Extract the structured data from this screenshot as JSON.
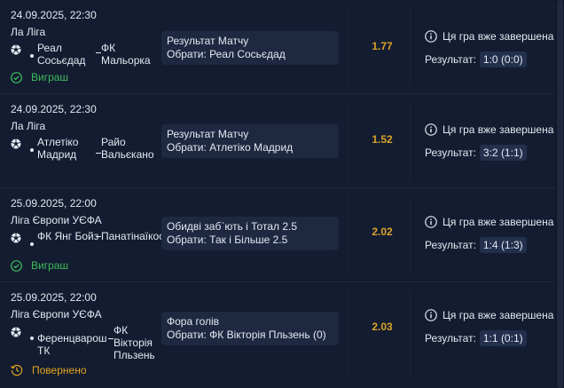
{
  "bets": [
    {
      "date": "24.09.2025, 22:30",
      "league": "Ла Ліга",
      "home": "Реал Сосьєдад",
      "away": "ФК Мальорка",
      "market": "Результат Матчу",
      "pick": "Обрати: Реал Сосьєдад",
      "odds": "1.77",
      "finished": "Ця гра вже завершена",
      "result_label": "Результат:",
      "score": "1:0 (0:0)",
      "status": "Виграш",
      "status_type": "won"
    },
    {
      "date": "24.09.2025, 22:30",
      "league": "Ла Ліга",
      "home": "Атлетіко Мадрид",
      "away": "Райо Вальєкано",
      "market": "Результат Матчу",
      "pick": "Обрати: Атлетіко Мадрид",
      "odds": "1.52",
      "finished": "Ця гра вже завершена",
      "result_label": "Результат:",
      "score": "3:2 (1:1)",
      "status": "",
      "status_type": "none"
    },
    {
      "date": "25.09.2025, 22:00",
      "league": "Ліга Європи УЄФА",
      "home": "ФК Янг Бойз",
      "away": "Панатінаїкос",
      "market": "Обидві заб`ють і Тотал 2.5",
      "pick": "Обрати: Так і Більше 2.5",
      "odds": "2.02",
      "finished": "Ця гра вже завершена",
      "result_label": "Результат:",
      "score": "1:4 (1:3)",
      "status": "Виграш",
      "status_type": "won"
    },
    {
      "date": "25.09.2025, 22:00",
      "league": "Ліга Європи УЄФА",
      "home": "Ференцварош ТК",
      "away": "ФК Вікторія Пльзень",
      "market": "Фора голів",
      "pick": "Обрати: ФК Вікторія Пльзень (0)",
      "odds": "2.03",
      "finished": "Ця гра вже завершена",
      "result_label": "Результат:",
      "score": "1:1 (0:1)",
      "status": "Повернено",
      "status_type": "returned"
    }
  ],
  "colors": {
    "won": "#3dbd5e",
    "returned": "#e2a51c",
    "odds": "#d9a32a"
  },
  "icons": {
    "sport": "soccer-ball-icon",
    "won": "check-circle-icon",
    "returned": "clock-return-icon",
    "info": "info-circle-icon"
  }
}
